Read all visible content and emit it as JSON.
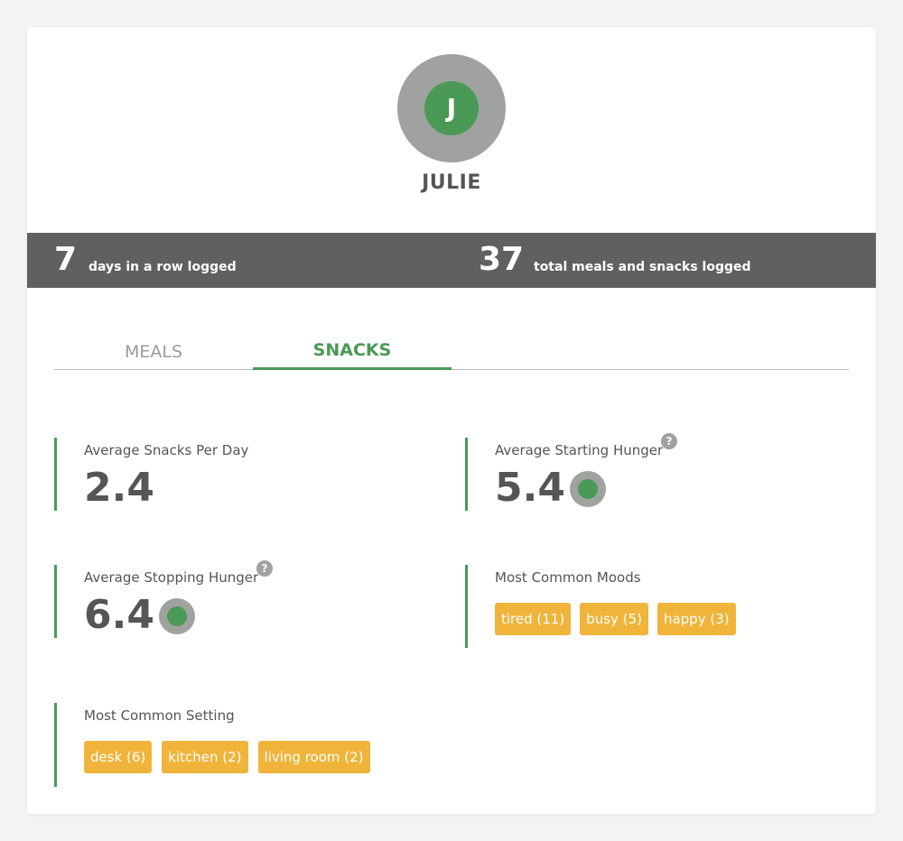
{
  "user": {
    "initial": "J",
    "name": "JULIE"
  },
  "stats": {
    "streak_value": "7",
    "streak_label": "days in a row logged",
    "total_value": "37",
    "total_label": "total meals and snacks logged"
  },
  "tabs": [
    {
      "label": "MEALS",
      "active": false
    },
    {
      "label": "SNACKS",
      "active": true
    }
  ],
  "metrics": {
    "avg_snacks": {
      "label": "Average Snacks Per Day",
      "value": "2.4"
    },
    "avg_start_hunger": {
      "label": "Average Starting Hunger",
      "value": "5.4",
      "help": "?"
    },
    "avg_stop_hunger": {
      "label": "Average Stopping Hunger",
      "value": "6.4",
      "help": "?"
    }
  },
  "moods": {
    "label": "Most Common Moods",
    "tags": [
      "tired (11)",
      "busy (5)",
      "happy (3)"
    ]
  },
  "setting": {
    "label": "Most Common Setting",
    "tags": [
      "desk (6)",
      "kitchen (2)",
      "living room (2)"
    ]
  },
  "colors": {
    "accent_green": "#4a9957",
    "avatar_gray": "#a0a29f",
    "stats_bar": "#606060",
    "tag_orange": "#f0b43a"
  }
}
